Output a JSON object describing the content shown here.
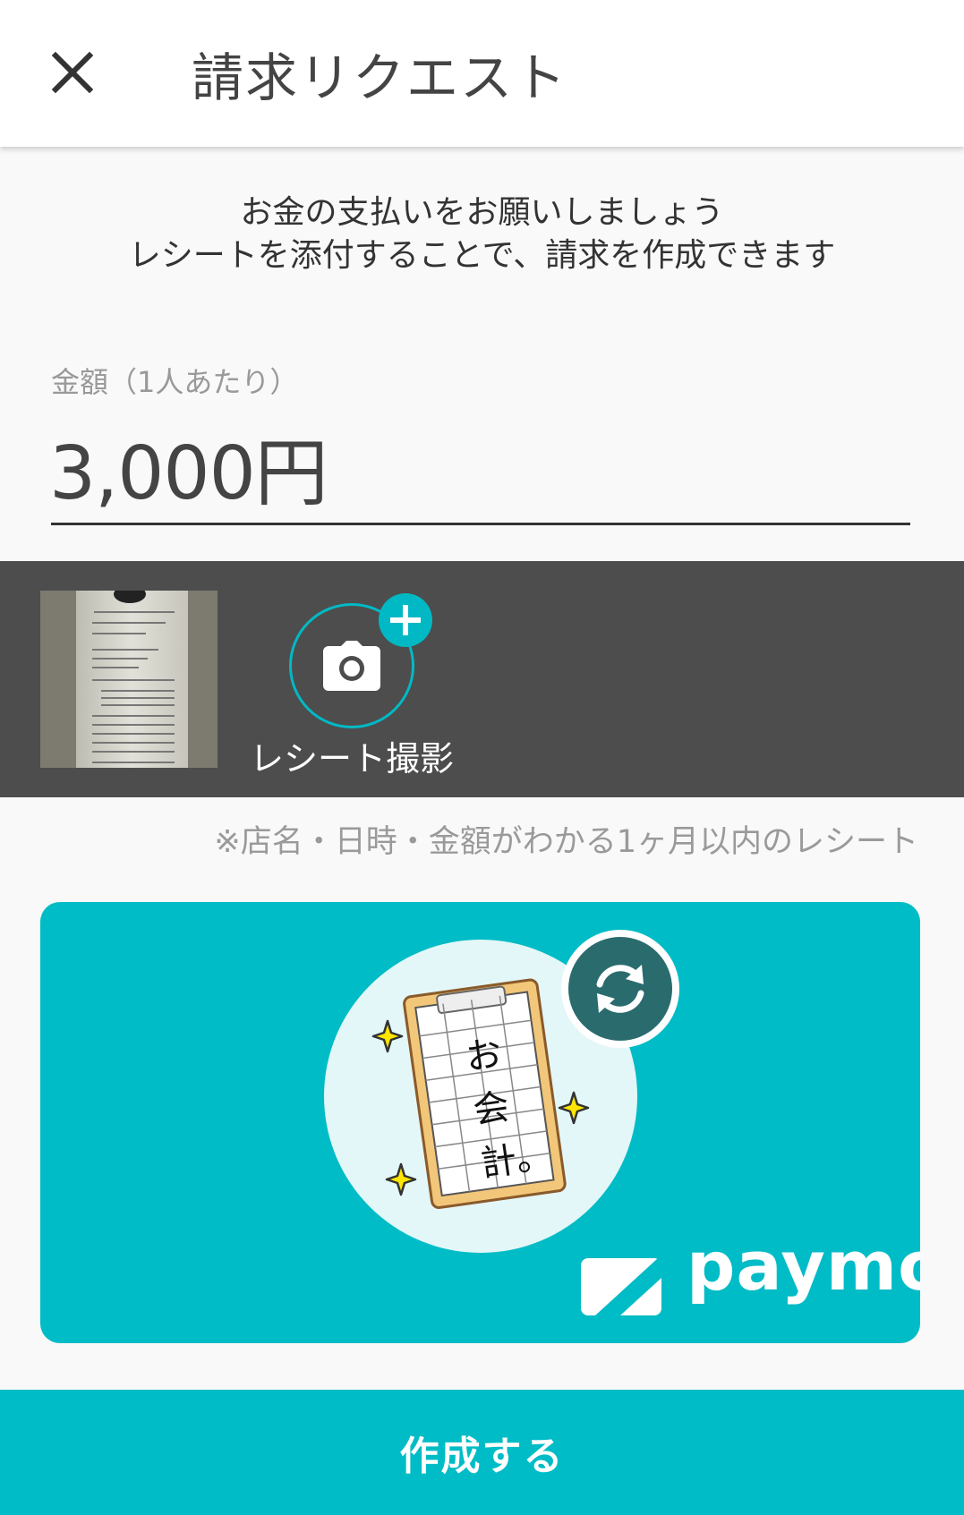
{
  "header": {
    "title": "請求リクエスト",
    "close_icon": "close-icon"
  },
  "intro": {
    "line1": "お金の支払いをお願いしましょう",
    "line2": "レシートを添付することで、請求を作成できます"
  },
  "amount": {
    "label": "金額（1人あたり）",
    "value": "3,000円"
  },
  "receipt": {
    "camera_label": "レシート撮影",
    "camera_icon": "camera-icon",
    "add_icon": "plus-icon",
    "note": "※店名・日時・金額がわかる1ヶ月以内のレシート"
  },
  "banner": {
    "illustration_text": "お会計。",
    "refresh_icon": "refresh-icon",
    "logo_text": "paymo"
  },
  "action": {
    "create_label": "作成する"
  },
  "colors": {
    "accent": "#00bcc6",
    "strip_bg": "#4d4d4d",
    "page_bg": "#f9f9f9"
  }
}
